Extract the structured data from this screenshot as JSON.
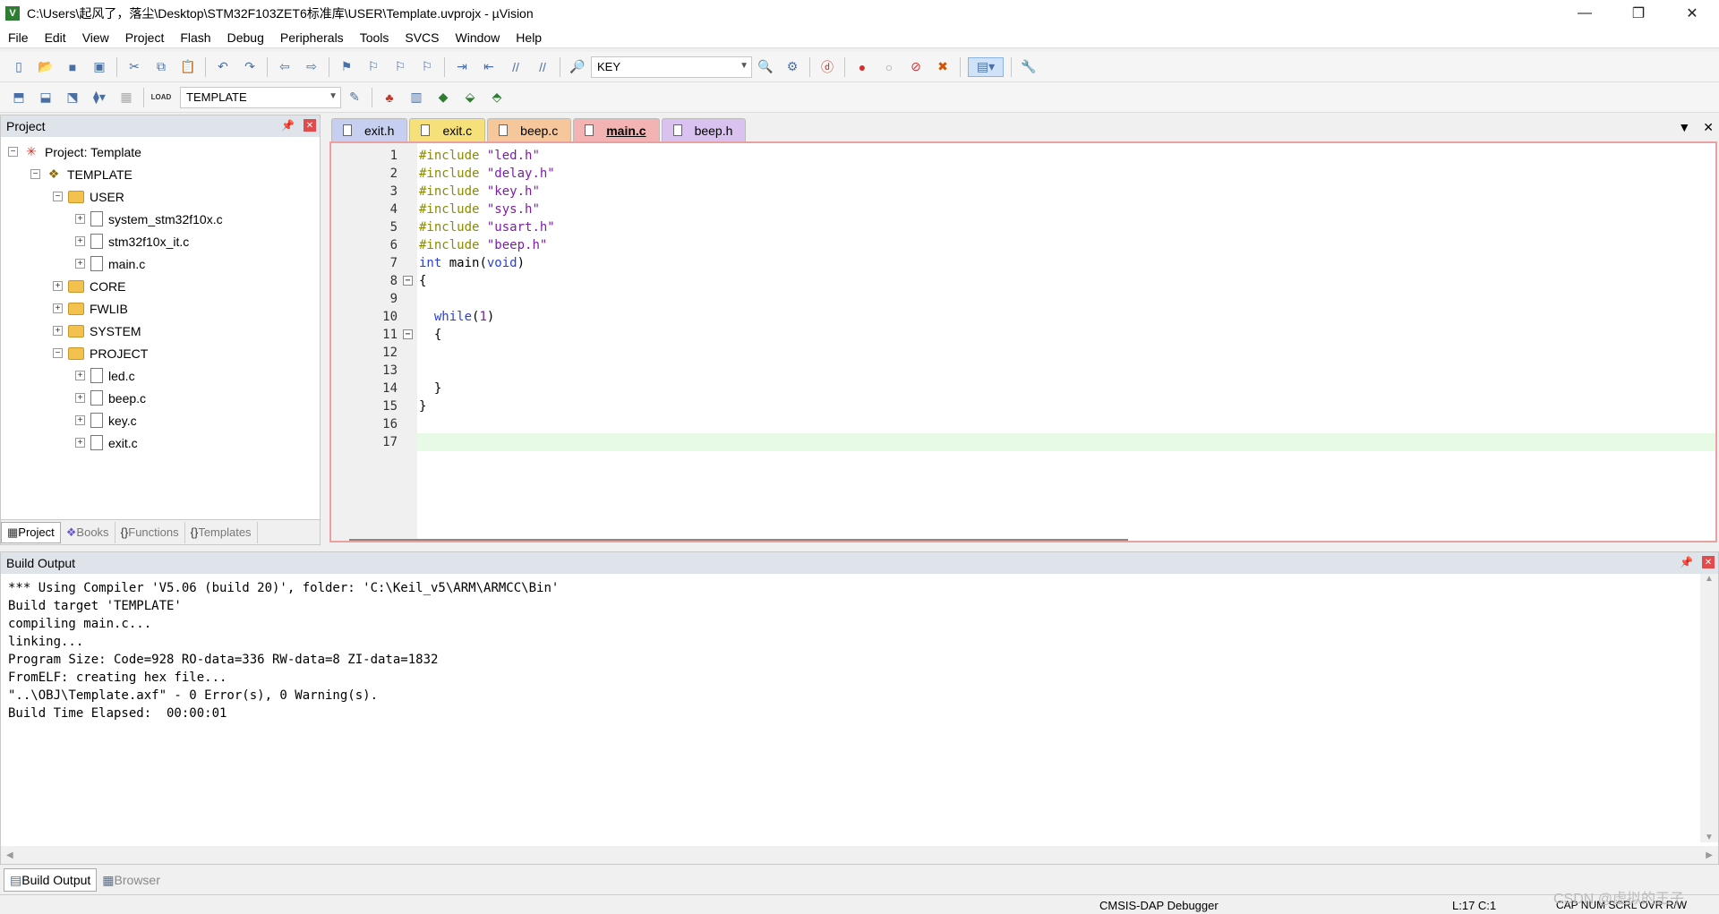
{
  "window": {
    "title": "C:\\Users\\起风了，落尘\\Desktop\\STM32F103ZET6标准库\\USER\\Template.uvprojx - µVision",
    "minimize": "—",
    "maximize": "❐",
    "close": "✕"
  },
  "menu": [
    "File",
    "Edit",
    "View",
    "Project",
    "Flash",
    "Debug",
    "Peripherals",
    "Tools",
    "SVCS",
    "Window",
    "Help"
  ],
  "toolbar1": {
    "find_value": "KEY"
  },
  "toolbar2": {
    "target_value": "TEMPLATE",
    "load_label": "LOAD"
  },
  "project_panel": {
    "title": "Project",
    "tree": [
      {
        "label": "Project: Template",
        "level": 0,
        "type": "project",
        "expand": "−"
      },
      {
        "label": "TEMPLATE",
        "level": 1,
        "type": "target",
        "expand": "−"
      },
      {
        "label": "USER",
        "level": 2,
        "type": "folder",
        "expand": "−"
      },
      {
        "label": "system_stm32f10x.c",
        "level": 3,
        "type": "file",
        "expand": "+"
      },
      {
        "label": "stm32f10x_it.c",
        "level": 3,
        "type": "file",
        "expand": "+"
      },
      {
        "label": "main.c",
        "level": 3,
        "type": "file",
        "expand": "+"
      },
      {
        "label": "CORE",
        "level": 2,
        "type": "folder",
        "expand": "+"
      },
      {
        "label": "FWLIB",
        "level": 2,
        "type": "folder",
        "expand": "+"
      },
      {
        "label": "SYSTEM",
        "level": 2,
        "type": "folder",
        "expand": "+"
      },
      {
        "label": "PROJECT",
        "level": 2,
        "type": "folder",
        "expand": "−"
      },
      {
        "label": "led.c",
        "level": 3,
        "type": "file",
        "expand": "+"
      },
      {
        "label": "beep.c",
        "level": 3,
        "type": "file",
        "expand": "+"
      },
      {
        "label": "key.c",
        "level": 3,
        "type": "file",
        "expand": "+"
      },
      {
        "label": "exit.c",
        "level": 3,
        "type": "file",
        "expand": "+"
      }
    ],
    "tabs": [
      "Project",
      "Books",
      "Functions",
      "Templates"
    ]
  },
  "editor": {
    "tabs": [
      {
        "label": "exit.h",
        "color": "#c6cff0",
        "active": false
      },
      {
        "label": "exit.c",
        "color": "#f5e07a",
        "active": false
      },
      {
        "label": "beep.c",
        "color": "#f6c79a",
        "active": false
      },
      {
        "label": "main.c",
        "color": "#f3b3b3",
        "active": true
      },
      {
        "label": "beep.h",
        "color": "#d9c2ef",
        "active": false
      }
    ],
    "lines": [
      {
        "n": "1",
        "code": "#include \"led.h\""
      },
      {
        "n": "2",
        "code": "#include \"delay.h\""
      },
      {
        "n": "3",
        "code": "#include \"key.h\""
      },
      {
        "n": "4",
        "code": "#include \"sys.h\""
      },
      {
        "n": "5",
        "code": "#include \"usart.h\""
      },
      {
        "n": "6",
        "code": "#include \"beep.h\""
      },
      {
        "n": "7",
        "code": "int main(void)"
      },
      {
        "n": "8",
        "code": "{",
        "fold": true
      },
      {
        "n": "9",
        "code": ""
      },
      {
        "n": "10",
        "code": "  while(1)"
      },
      {
        "n": "11",
        "code": "  {",
        "fold": true
      },
      {
        "n": "12",
        "code": ""
      },
      {
        "n": "13",
        "code": ""
      },
      {
        "n": "14",
        "code": "  }"
      },
      {
        "n": "15",
        "code": "}"
      },
      {
        "n": "16",
        "code": ""
      },
      {
        "n": "17",
        "code": "",
        "current": true
      }
    ]
  },
  "build_output": {
    "title": "Build Output",
    "lines": [
      "*** Using Compiler 'V5.06 (build 20)', folder: 'C:\\Keil_v5\\ARM\\ARMCC\\Bin'",
      "Build target 'TEMPLATE'",
      "compiling main.c...",
      "linking...",
      "Program Size: Code=928 RO-data=336 RW-data=8 ZI-data=1832",
      "FromELF: creating hex file...",
      "\"..\\OBJ\\Template.axf\" - 0 Error(s), 0 Warning(s).",
      "Build Time Elapsed:  00:00:01"
    ],
    "tabs": [
      "Build Output",
      "Browser"
    ]
  },
  "status": {
    "debugger": "CMSIS-DAP Debugger",
    "position": "L:17 C:1",
    "flags": "CAP  NUM  SCRL  OVR  R/W"
  },
  "watermark": "CSDN @虚拟的王子"
}
